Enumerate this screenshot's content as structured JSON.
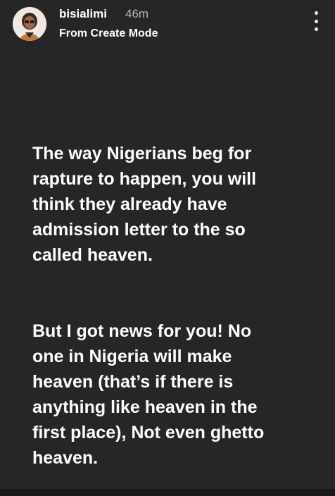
{
  "header": {
    "username": "bisialimi",
    "time_ago": "46m",
    "subtitle": "From Create Mode",
    "more_icon": "more-vertical-icon"
  },
  "post": {
    "paragraphs": [
      "The way Nigerians beg for\nrapture to happen, you will\nthink they already have\nadmission letter to the so\ncalled heaven.",
      "But I got news for you! No\none in Nigeria will make\nheaven (that’s if there is\nanything like heaven in the\nfirst place), Not even ghetto\nheaven."
    ]
  },
  "colors": {
    "background": "#262626",
    "text": "#ffffff",
    "muted": "#b5b5b5"
  }
}
